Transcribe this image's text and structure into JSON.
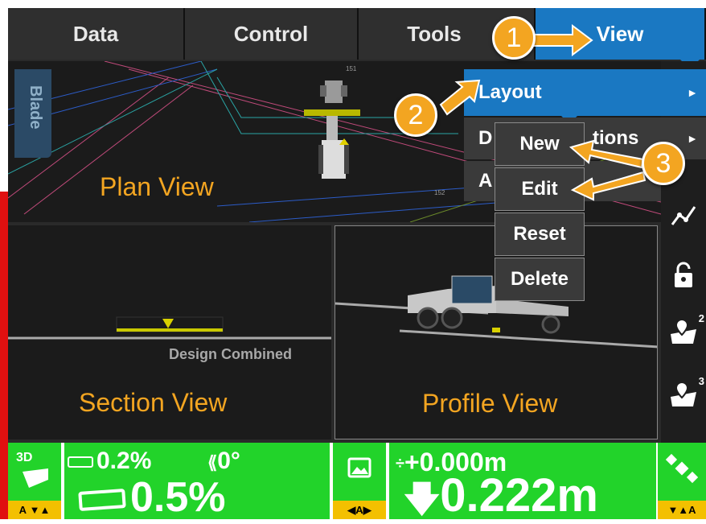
{
  "tabs": [
    {
      "label": "Data"
    },
    {
      "label": "Control"
    },
    {
      "label": "Tools"
    },
    {
      "label": "View",
      "active": true
    }
  ],
  "plan_view": {
    "label": "Plan View",
    "blade_tab": "Blade",
    "map_numbers": [
      "151",
      "152"
    ]
  },
  "section_view": {
    "label": "Section View",
    "design_label": "Design Combined"
  },
  "profile_view": {
    "label": "Profile View"
  },
  "view_menu": {
    "items": [
      {
        "label": "Layout"
      },
      {
        "label": "Display Options",
        "partial": "D"
      },
      {
        "label": "A"
      }
    ],
    "partial_suffix": "tions"
  },
  "layout_submenu": {
    "items": [
      "New",
      "Edit",
      "Reset",
      "Delete"
    ]
  },
  "callouts": [
    "1",
    "2",
    "3"
  ],
  "side_icons": [
    "graph-icon",
    "lock-icon",
    "map-pin-icon",
    "map-pin-icon"
  ],
  "side_icon_superscripts": [
    "2",
    "3"
  ],
  "status_bar": {
    "mode": "3D",
    "cross_slope_small": "0.2%",
    "rotation": "0°",
    "cross_slope_large": "0.5%",
    "elevation_offset": "+0.000m",
    "cut_fill": "0.222m",
    "ab_left": "A",
    "ab_right": "A",
    "ab_center": "A"
  },
  "colors": {
    "accent_orange": "#f3a521",
    "status_green": "#22d32a",
    "active_tab_blue": "#1a78c2",
    "left_edge_red": "#e01010"
  }
}
